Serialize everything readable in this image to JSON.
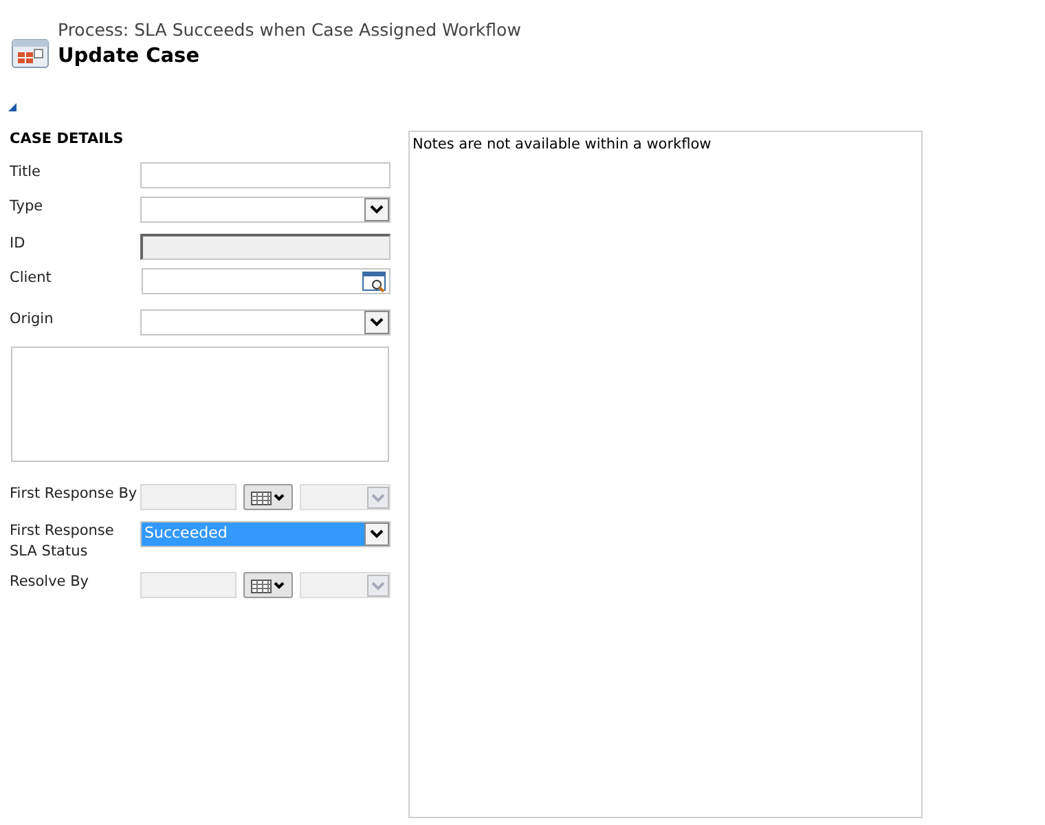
{
  "header": {
    "process": "Process: SLA Succeeds when Case Assigned Workflow",
    "title": "Update Case"
  },
  "section": {
    "expanded": true,
    "title": "CASE DETAILS"
  },
  "fields": [
    {
      "kind": "text",
      "label": "Title"
    },
    {
      "kind": "select",
      "label": "Type"
    },
    {
      "kind": "readonly",
      "label": "ID"
    },
    {
      "kind": "lookup",
      "label": "Client"
    },
    {
      "kind": "select",
      "label": "Origin"
    },
    {
      "kind": "textarea"
    },
    {
      "kind": "datetime",
      "label": "First Response By",
      "disabled": true
    },
    {
      "kind": "select",
      "label": "First Response SLA Status",
      "value": "Succeeded",
      "selected": true
    },
    {
      "kind": "datetime",
      "label": "Resolve By",
      "disabled": true
    }
  ],
  "notes": {
    "message": "Notes are not available within a workflow"
  }
}
